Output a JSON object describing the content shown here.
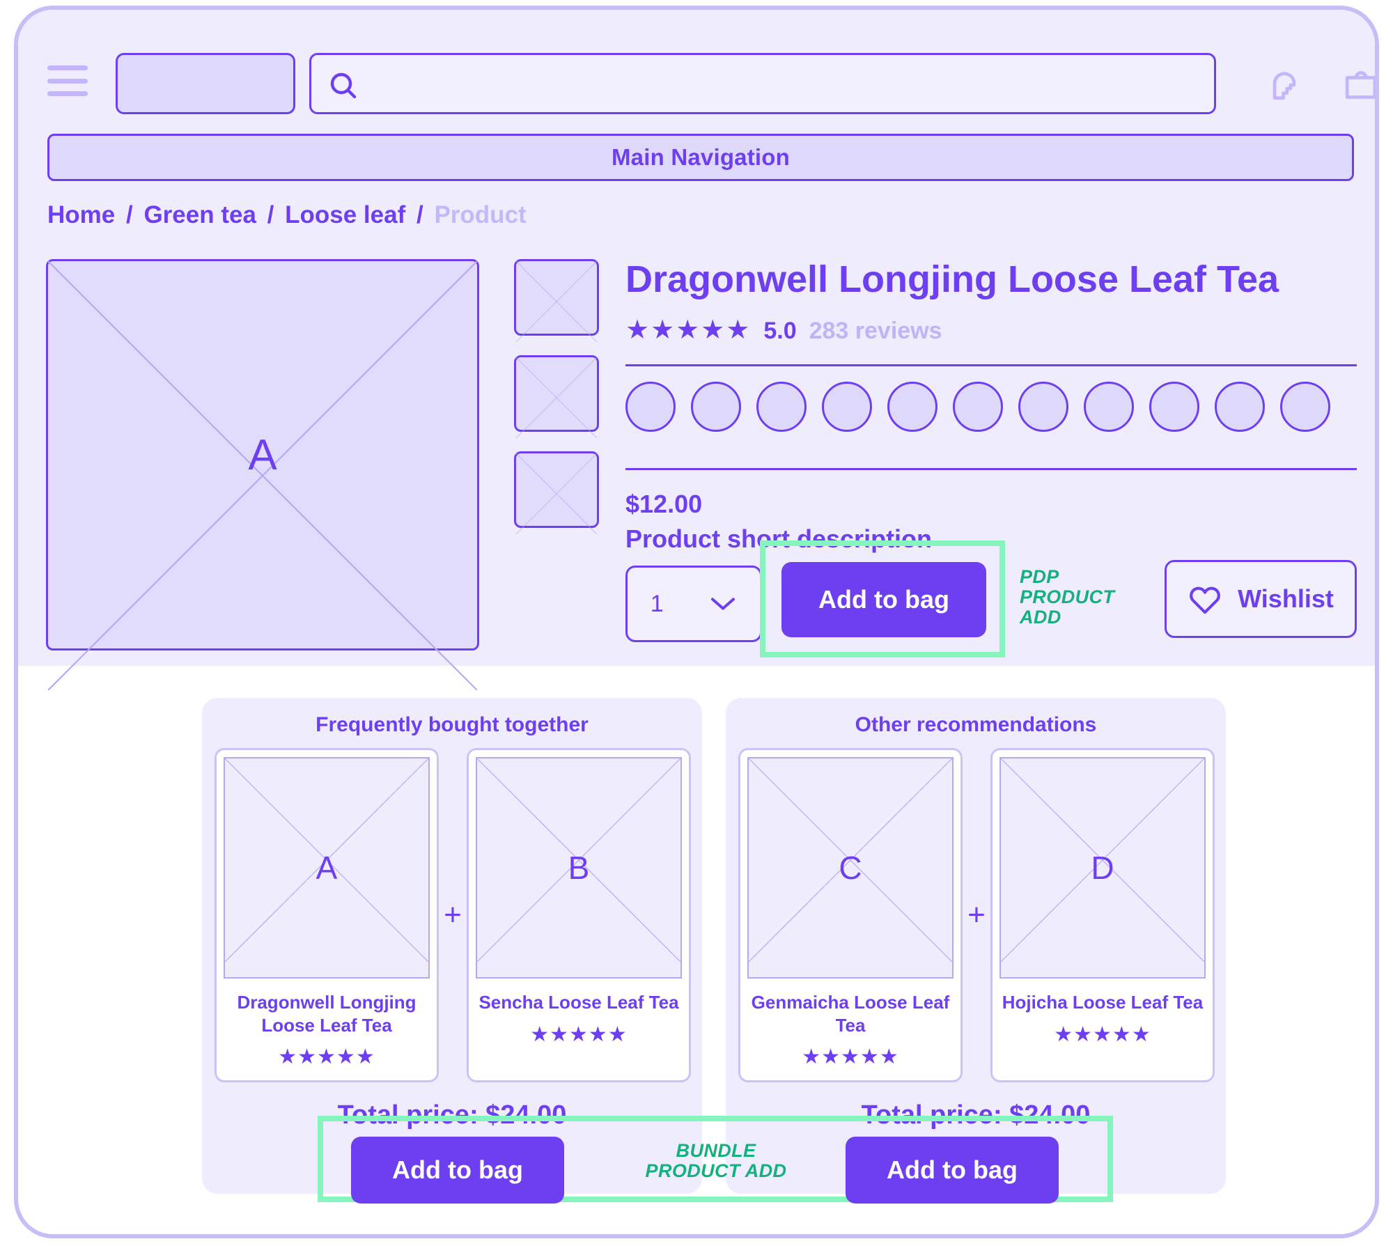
{
  "header": {
    "menu_icon": "hamburger-icon",
    "logo_placeholder": "",
    "search_icon": "search-icon",
    "search_placeholder": "",
    "search_value": "",
    "account_icon": "account-head-icon",
    "bag_icon": "shopping-bag-icon"
  },
  "main_nav": {
    "label": "Main Navigation"
  },
  "breadcrumb": {
    "items": [
      {
        "label": "Home",
        "muted": false
      },
      {
        "label": "Green tea",
        "muted": false
      },
      {
        "label": "Loose leaf",
        "muted": false
      },
      {
        "label": "Product",
        "muted": true
      }
    ],
    "separator": "/"
  },
  "gallery": {
    "main_image_label": "A",
    "thumbnails": [
      "",
      "",
      ""
    ]
  },
  "product": {
    "title": "Dragonwell Longjing Loose Leaf Tea",
    "stars": "★★★★★",
    "rating_value": "5.0",
    "review_count": "283 reviews",
    "swatch_count": 11,
    "price": "$12.00",
    "short_description": "Product short description",
    "quantity_value": "1",
    "add_to_bag_label": "Add to bag",
    "wishlist_label": "Wishlist",
    "wishlist_icon": "heart-icon",
    "chevron_icon": "chevron-down-icon"
  },
  "annotations": {
    "pdp": "PDP\nPRODUCT\nADD",
    "pdp_line1": "PDP",
    "pdp_line2": "PRODUCT",
    "pdp_line3": "ADD",
    "bundle_line1": "BUNDLE",
    "bundle_line2": "PRODUCT ADD",
    "highlight_color": "#85f5bd",
    "text_color": "#14b07d"
  },
  "recommendations": [
    {
      "title": "Frequently bought together",
      "plus": "+",
      "products": [
        {
          "image_label": "A",
          "name": "Dragonwell Longjing Loose Leaf Tea",
          "stars": "★★★★★"
        },
        {
          "image_label": "B",
          "name": "Sencha Loose Leaf Tea",
          "stars": "★★★★★"
        }
      ],
      "total_price": "Total price: $24.00",
      "add_to_bag_label": "Add to bag"
    },
    {
      "title": "Other recommendations",
      "plus": "+",
      "products": [
        {
          "image_label": "C",
          "name": "Genmaicha Loose Leaf Tea",
          "stars": "★★★★★"
        },
        {
          "image_label": "D",
          "name": "Hojicha Loose Leaf Tea",
          "stars": "★★★★★"
        }
      ],
      "total_price": "Total price: $24.00",
      "add_to_bag_label": "Add to bag"
    }
  ],
  "colors": {
    "accent": "#6d3ff0",
    "surface": "#efedfd",
    "surface_alt": "#ded9fb",
    "muted_text": "#c4b8f8",
    "annotation": "#14b07d",
    "highlight": "#85f5bd"
  }
}
